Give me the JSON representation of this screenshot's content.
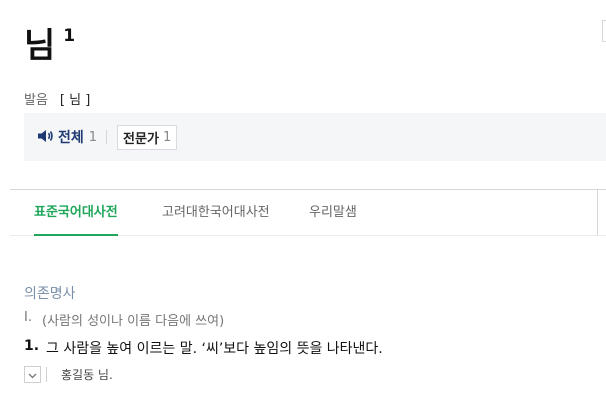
{
  "entry": {
    "headword": "님",
    "homonym_number": "1"
  },
  "pronunciation": {
    "label": "발음",
    "value": "[ 님 ]"
  },
  "audio": {
    "all_label": "전체",
    "all_count": "1",
    "expert_label": "전문가",
    "expert_count": "1"
  },
  "tabs": [
    {
      "label": "표준국어대사전",
      "active": true
    },
    {
      "label": "고려대한국어대사전",
      "active": false
    },
    {
      "label": "우리말샘",
      "active": false
    }
  ],
  "sense": {
    "part_of_speech": "의존명사",
    "roman_numeral": "Ⅰ.",
    "usage_note": "(사람의 성이나 이름 다음에 쓰여)",
    "definition_number": "1.",
    "definition_text": "그 사람을 높여 이르는 말. ‘씨’보다 높임의 뜻을 나타낸다.",
    "example_text": "홍길동 님."
  },
  "colors": {
    "accent_green": "#1fa65b",
    "navy": "#1f3a72",
    "pos_blue_gray": "#7a90a8"
  }
}
